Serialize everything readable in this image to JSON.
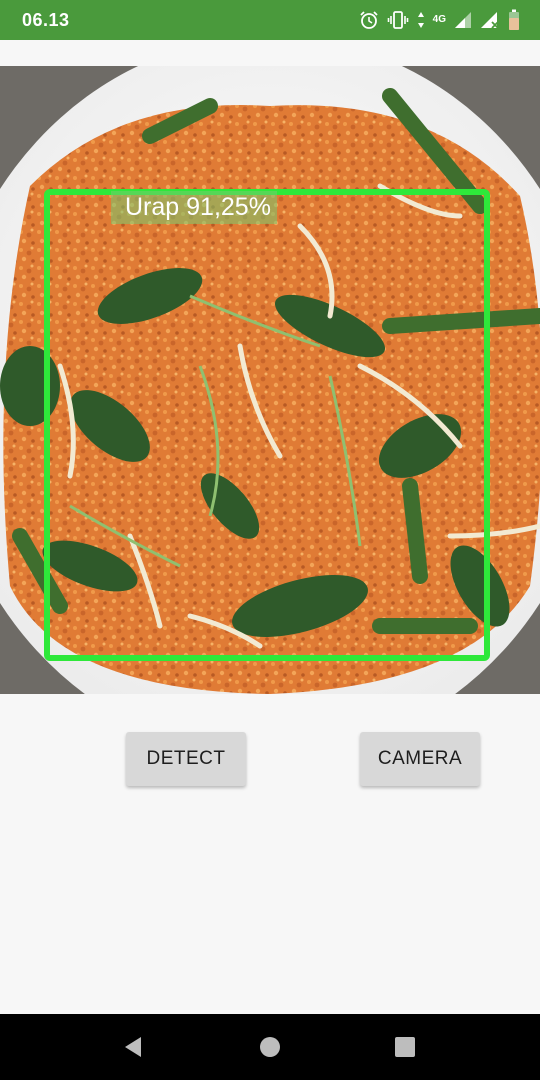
{
  "status_bar": {
    "time": "06.13",
    "network_label": "4G",
    "icons": [
      "alarm-icon",
      "vibrate-icon",
      "data-arrows-icon",
      "signal-icon",
      "signal-no-sim-icon",
      "battery-icon"
    ],
    "background": "#4a9a3c"
  },
  "detection": {
    "label": "Urap 91,25%",
    "box_color": "#2ee83a"
  },
  "buttons": {
    "detect_label": "DETECT",
    "camera_label": "CAMERA"
  },
  "nav_bar": {
    "icons": [
      "back-icon",
      "home-icon",
      "recents-icon"
    ]
  }
}
